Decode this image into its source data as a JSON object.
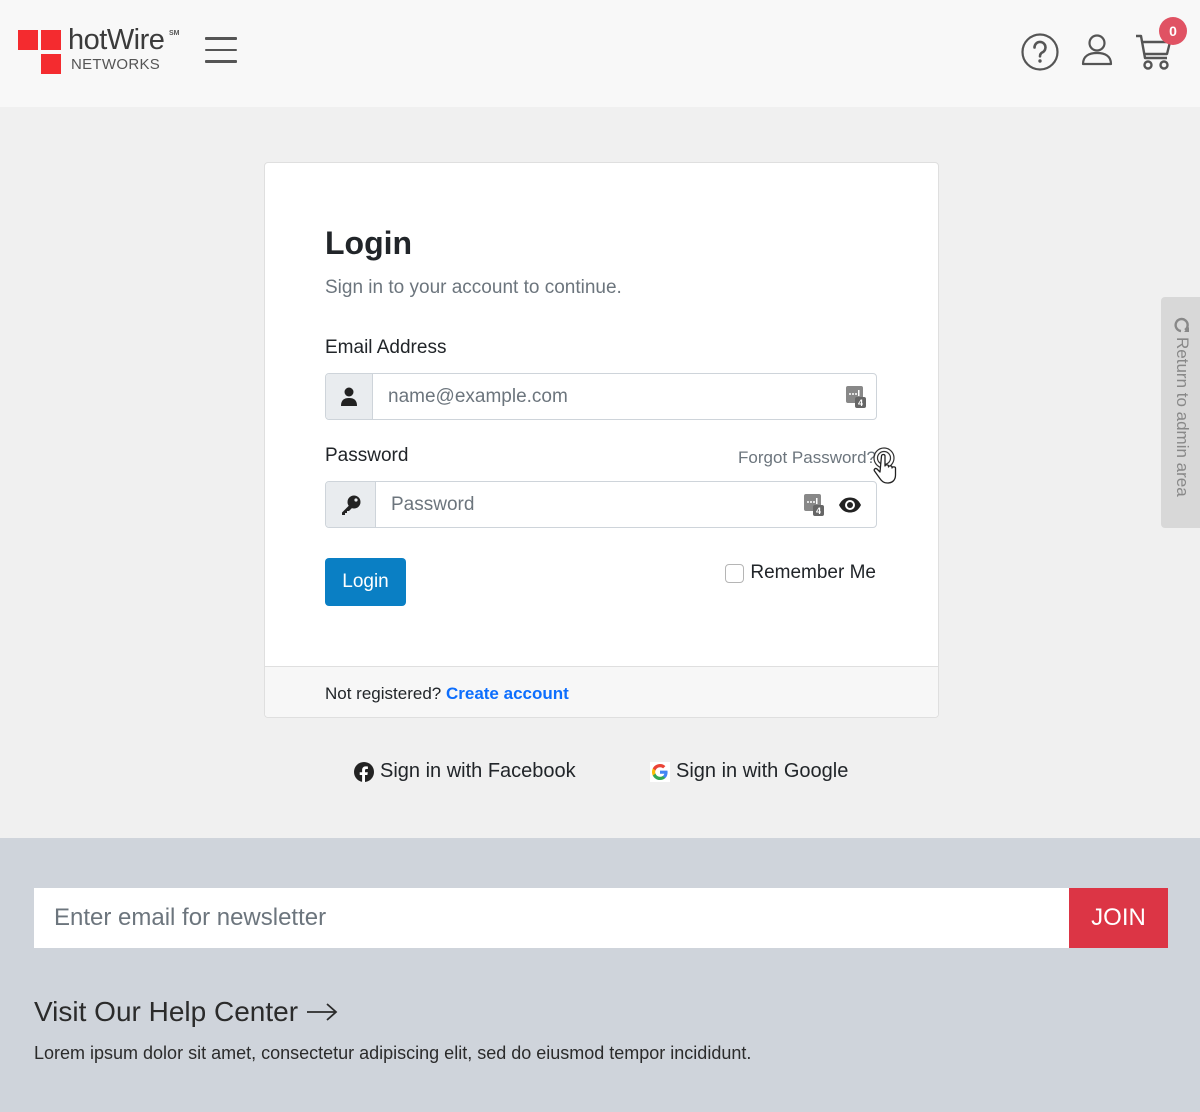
{
  "header": {
    "logo": {
      "brand": "hotWire",
      "trademark": "SM",
      "subtitle": "NETWORKS",
      "color": "#f42b2f"
    },
    "menu_icon": "hamburger-icon",
    "icons": [
      "help-icon",
      "user-icon",
      "cart-icon"
    ],
    "cart_count": "0"
  },
  "login": {
    "title": "Login",
    "subtitle": "Sign in to your account to continue.",
    "email_label": "Email Address",
    "email_placeholder": "name@example.com",
    "password_label": "Password",
    "forgot_password": "Forgot Password?",
    "password_placeholder": "Password",
    "login_button": "Login",
    "remember_me": "Remember Me",
    "remember_checked": false,
    "not_registered": "Not registered?",
    "create_account": "Create account",
    "accent_color": "#0a7fc4"
  },
  "social": {
    "facebook": "Sign in with Facebook",
    "google": "Sign in with Google"
  },
  "side_tab": {
    "label": "Return to admin area"
  },
  "footer": {
    "newsletter_placeholder": "Enter email for newsletter",
    "join_button": "JOIN",
    "join_color": "#dc3545",
    "help_center": "Visit Our Help Center",
    "lorem": "Lorem ipsum dolor sit amet, consectetur adipiscing elit, sed do eiusmod tempor incididunt."
  }
}
